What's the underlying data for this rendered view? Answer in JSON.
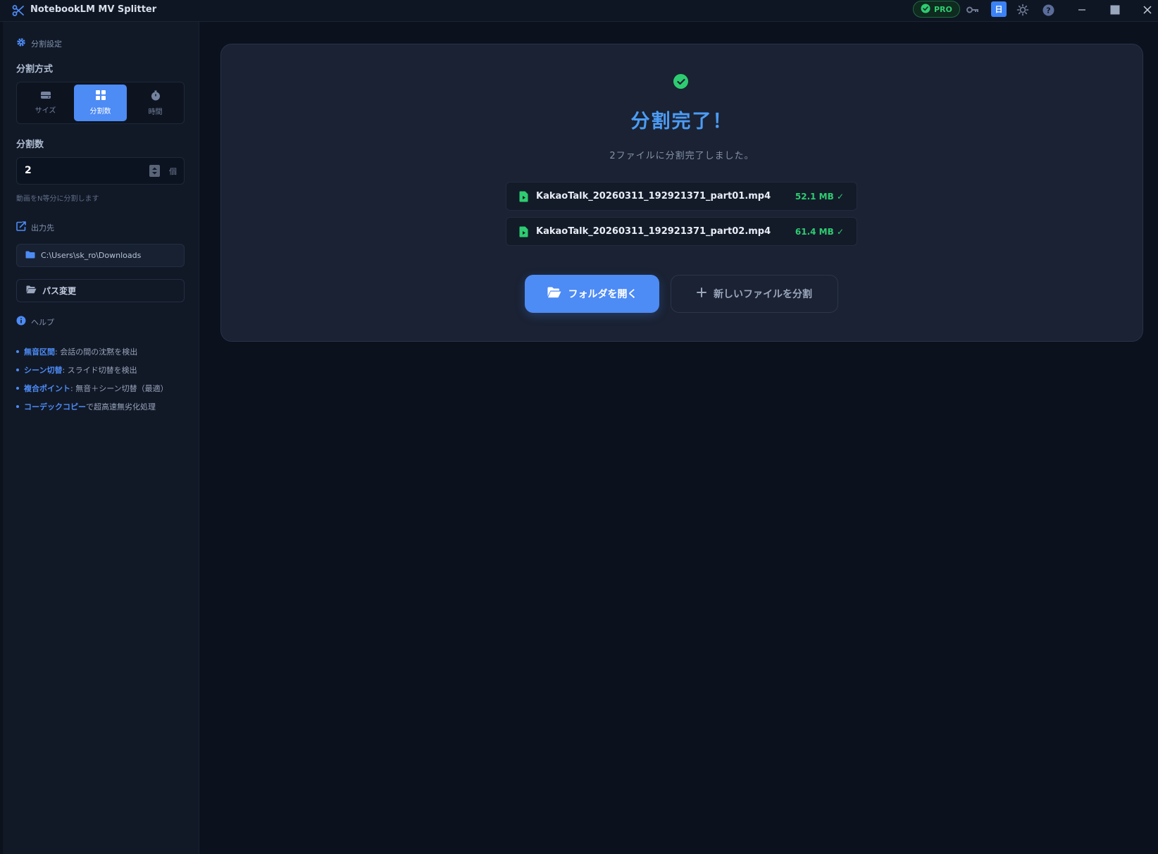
{
  "app": {
    "title": "NotebookLM MV Splitter",
    "pro_label": "PRO",
    "lang_label": "日"
  },
  "sidebar": {
    "settings_head": "分割設定",
    "mode_label": "分割方式",
    "modes": [
      {
        "label": "サイズ",
        "icon": "hdd-icon",
        "active": false
      },
      {
        "label": "分割数",
        "icon": "grid-icon",
        "active": true
      },
      {
        "label": "時間",
        "icon": "stopwatch-icon",
        "active": false
      }
    ],
    "count_label": "分割数",
    "count_value": "2",
    "count_unit": "個",
    "count_hint": "動画をN等分に分割します",
    "output_head": "出力先",
    "output_path": "C:\\Users\\sk_ro\\Downloads",
    "change_path": "パス変更",
    "help_head": "ヘルプ",
    "help_items": [
      {
        "key": "無音区間",
        "text": ": 会話の間の沈黙を検出"
      },
      {
        "key": "シーン切替",
        "text": ": スライド切替を検出"
      },
      {
        "key": "複合ポイント",
        "text": ": 無音＋シーン切替（最適）"
      },
      {
        "key": "コーデックコピー",
        "text": " で超高速無劣化処理"
      }
    ]
  },
  "main": {
    "title": "分割完了！",
    "subtitle": "2ファイルに分割完了しました。",
    "files": [
      {
        "name": "KakaoTalk_20260311_192921371_part01.mp4",
        "size": "52.1 MB ✓"
      },
      {
        "name": "KakaoTalk_20260311_192921371_part02.mp4",
        "size": "61.4 MB ✓"
      }
    ],
    "open_folder": "フォルダを開く",
    "new_split": "新しいファイルを分割"
  },
  "colors": {
    "accent": "#4d8bf5",
    "success": "#2ecc71",
    "background": "#0b111d",
    "card": "#1a2233"
  }
}
